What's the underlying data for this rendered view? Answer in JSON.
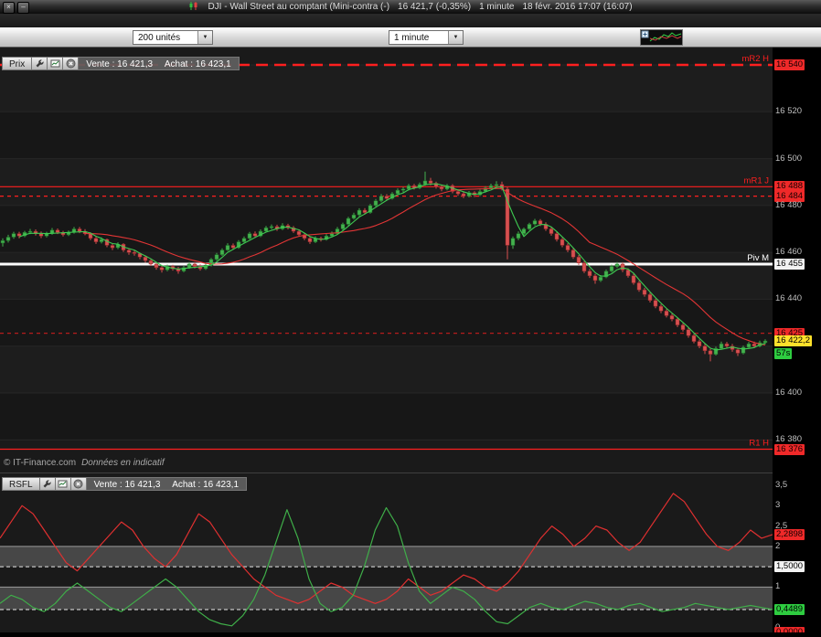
{
  "window": {
    "title_instrument": "DJI - Wall Street au comptant (Mini-contra (-)",
    "title_price": "16 421,7 (-0,35%)",
    "title_timeframe": "1 minute",
    "title_datetime": "18 févr. 2016 17:07 (16:07)"
  },
  "icons": {
    "close": "×",
    "minimize": "–",
    "dropdown": "▼"
  },
  "toolbar": {
    "units_select": "200 unités",
    "timeframe_select": "1 minute"
  },
  "price_panel": {
    "name": "Prix",
    "sell": "Vente : 16 421,3",
    "buy": "Achat : 16 423,1",
    "copyright": "© IT-Finance.com",
    "copyright_note": "Données en indicatif",
    "levels": [
      {
        "name": "mR2 H",
        "price": 16540,
        "style": "dashed-bold",
        "color": "#ff1f1f"
      },
      {
        "name": "mR1 J",
        "price": 16488,
        "style": "solid",
        "color": "#ff1f1f"
      },
      {
        "name": "",
        "price": 16484,
        "style": "dashed",
        "color": "#ff1f1f"
      },
      {
        "name": "Piv M",
        "price": 16455,
        "style": "solid-bold",
        "color": "#ffffff"
      },
      {
        "name": "",
        "price": 16425.5,
        "style": "dashed",
        "color": "#b51d1d"
      },
      {
        "name": "R1 H",
        "price": 16376,
        "style": "solid",
        "color": "#ff1f1f"
      }
    ],
    "axis_labels": [
      {
        "text": "16 540",
        "v": 16540,
        "type": "red"
      },
      {
        "text": "16 520",
        "v": 16520,
        "type": "plain"
      },
      {
        "text": "16 500",
        "v": 16500,
        "type": "plain"
      },
      {
        "text": "16 488",
        "v": 16488,
        "type": "red"
      },
      {
        "text": "16 484",
        "v": 16484,
        "type": "red"
      },
      {
        "text": "16 480",
        "v": 16480,
        "type": "plain"
      },
      {
        "text": "16 460",
        "v": 16460,
        "type": "plain"
      },
      {
        "text": "16 455",
        "v": 16455,
        "type": "white"
      },
      {
        "text": "16 440",
        "v": 16440,
        "type": "plain"
      },
      {
        "text": "16 425",
        "v": 16425.5,
        "type": "red"
      },
      {
        "text": "16 422,2",
        "v": 16422.2,
        "type": "yellow"
      },
      {
        "text": "57s",
        "v": 16416.6,
        "type": "green"
      },
      {
        "text": "16 400",
        "v": 16400,
        "type": "plain"
      },
      {
        "text": "16 380",
        "v": 16380,
        "type": "plain"
      },
      {
        "text": "16 376",
        "v": 16376,
        "type": "red"
      }
    ]
  },
  "rsfl_panel": {
    "name": "RSFL",
    "sell": "Vente : 16 421,3",
    "buy": "Achat : 16 423,1",
    "axis_labels": [
      {
        "text": "3,5",
        "v": 3.5,
        "type": "plain"
      },
      {
        "text": "3",
        "v": 3,
        "type": "plain"
      },
      {
        "text": "2,5",
        "v": 2.5,
        "type": "plain"
      },
      {
        "text": "2,2898",
        "v": 2.2898,
        "type": "red"
      },
      {
        "text": "2",
        "v": 2,
        "type": "plain"
      },
      {
        "text": "1,5000",
        "v": 1.5,
        "type": "white"
      },
      {
        "text": "1",
        "v": 1,
        "type": "plain"
      },
      {
        "text": "0,4489",
        "v": 0.4489,
        "type": "green"
      },
      {
        "text": "0",
        "v": 0,
        "type": "plain"
      },
      {
        "text": "0,0000",
        "v": -0.1,
        "type": "red"
      }
    ]
  },
  "chart_data": [
    {
      "type": "candlestick",
      "title": "DJI - Wall Street au comptant, 1 minute",
      "ylabel": "Prix",
      "ylim": [
        16368,
        16548
      ],
      "base": 16400,
      "gridlines": [
        16540,
        16520,
        16500,
        16480,
        16460,
        16440,
        16420,
        16400,
        16380
      ],
      "ma_fast_period": 4,
      "ma_slow_period": 16,
      "colors": {
        "up": "#44b14e",
        "up_border": "#1d6e26",
        "down": "#d75050",
        "down_border": "#8f2727",
        "ma_fast": "#3ecb52",
        "ma_slow": "#e23535"
      },
      "candles_ohlc_offset": [
        [
          64,
          66,
          62.5,
          65
        ],
        [
          65,
          67.5,
          64.2,
          66.5
        ],
        [
          66.5,
          68.8,
          65.8,
          68
        ],
        [
          68,
          68.8,
          66,
          67
        ],
        [
          67,
          69.2,
          66.5,
          68.5
        ],
        [
          68.5,
          70,
          67.8,
          69
        ],
        [
          69,
          69.8,
          67.2,
          68
        ],
        [
          68,
          68.9,
          66.1,
          67
        ],
        [
          67,
          68.8,
          66.4,
          68
        ],
        [
          68,
          70.4,
          67.5,
          69.5
        ],
        [
          69.5,
          70.2,
          67.8,
          68.5
        ],
        [
          68.5,
          69.2,
          66.8,
          67.5
        ],
        [
          67.5,
          69.3,
          67,
          68.5
        ],
        [
          68.5,
          70.8,
          68,
          70
        ],
        [
          70,
          70.8,
          68.2,
          69
        ],
        [
          69,
          69.9,
          67.3,
          68
        ],
        [
          68,
          68.6,
          65.2,
          66
        ],
        [
          66,
          66.8,
          63.6,
          64.5
        ],
        [
          64.5,
          66.4,
          63.8,
          65.5
        ],
        [
          65.5,
          65.9,
          62.2,
          63
        ],
        [
          63,
          63.9,
          61,
          62
        ],
        [
          62,
          64.3,
          61.4,
          63.5
        ],
        [
          63.5,
          63.9,
          60.2,
          61
        ],
        [
          61,
          61.8,
          59,
          60
        ],
        [
          60,
          60.9,
          58.6,
          59.5
        ],
        [
          59.5,
          59.9,
          57.1,
          58
        ],
        [
          58,
          58.7,
          55.6,
          56.5
        ],
        [
          56.5,
          57.2,
          54.2,
          55
        ],
        [
          55,
          55.8,
          52.6,
          53.5
        ],
        [
          53.5,
          54.2,
          51.4,
          52.5
        ],
        [
          52.5,
          54.8,
          51.9,
          54
        ],
        [
          54,
          54.7,
          52.2,
          53
        ],
        [
          53,
          53.8,
          50.9,
          52
        ],
        [
          52,
          54.2,
          51.5,
          53.5
        ],
        [
          53.5,
          55.9,
          53,
          55
        ],
        [
          55,
          55.8,
          53.1,
          54
        ],
        [
          54,
          54.9,
          52.2,
          53
        ],
        [
          53,
          55.2,
          52.5,
          54.5
        ],
        [
          54.5,
          57.6,
          54,
          57
        ],
        [
          57,
          59.8,
          56.4,
          59
        ],
        [
          59,
          61.7,
          58.5,
          61
        ],
        [
          61,
          63.9,
          60.6,
          63
        ],
        [
          63,
          63.8,
          61.2,
          62
        ],
        [
          62,
          65.2,
          61.5,
          64.5
        ],
        [
          64.5,
          66.8,
          64,
          66
        ],
        [
          66,
          68.7,
          65.5,
          68
        ],
        [
          68,
          68.9,
          66.2,
          67
        ],
        [
          67,
          69.8,
          66.5,
          69
        ],
        [
          69,
          71.3,
          68.5,
          70.5
        ],
        [
          70.5,
          71.9,
          69.8,
          71
        ],
        [
          71,
          71.8,
          69.2,
          70
        ],
        [
          70,
          72.4,
          69.5,
          71.5
        ],
        [
          71.5,
          72.2,
          69.8,
          70.5
        ],
        [
          70.5,
          71.2,
          68.3,
          69
        ],
        [
          69,
          69.8,
          66.9,
          67.5
        ],
        [
          67.5,
          68.2,
          65.2,
          66
        ],
        [
          66,
          66.8,
          63.6,
          64.5
        ],
        [
          64.5,
          66.9,
          64,
          66
        ],
        [
          66,
          66.7,
          64.6,
          65.5
        ],
        [
          65.5,
          67.8,
          65,
          67
        ],
        [
          67,
          68.9,
          66.4,
          68
        ],
        [
          68,
          70.8,
          67.5,
          70
        ],
        [
          70,
          72.7,
          69.4,
          72
        ],
        [
          72,
          75.2,
          71.5,
          74.5
        ],
        [
          74.5,
          76.9,
          74,
          76
        ],
        [
          76,
          78.8,
          75.4,
          78
        ],
        [
          78,
          78.9,
          76.2,
          77
        ],
        [
          77,
          80.7,
          76.5,
          80
        ],
        [
          80,
          82.8,
          79.5,
          82
        ],
        [
          82,
          84.9,
          81.4,
          84
        ],
        [
          84,
          84.8,
          82.2,
          83
        ],
        [
          83,
          85.7,
          82.5,
          85
        ],
        [
          85,
          87.3,
          84.5,
          86.5
        ],
        [
          86.5,
          87.9,
          85.6,
          87
        ],
        [
          87,
          89.2,
          86.4,
          88.5
        ],
        [
          88.5,
          89.2,
          86.8,
          87.5
        ],
        [
          87.5,
          89.8,
          87,
          89
        ],
        [
          89,
          94.5,
          88.4,
          90.5
        ],
        [
          90.5,
          91.8,
          88.6,
          89.5
        ],
        [
          89.5,
          90.2,
          87.2,
          88
        ],
        [
          88,
          88.9,
          86.1,
          87
        ],
        [
          87,
          89.2,
          86.5,
          88.5
        ],
        [
          88.5,
          89.1,
          85.2,
          86
        ],
        [
          86,
          86.9,
          84.1,
          85
        ],
        [
          85,
          85.8,
          83.2,
          84
        ],
        [
          84,
          86.2,
          83.5,
          85.5
        ],
        [
          85.5,
          86.1,
          83.6,
          84.5
        ],
        [
          84.5,
          86.8,
          84,
          86
        ],
        [
          86,
          88.2,
          85.5,
          87.5
        ],
        [
          87.5,
          89.3,
          87,
          88.5
        ],
        [
          88.5,
          90.4,
          87.8,
          89
        ],
        [
          89,
          90.2,
          86.4,
          87
        ],
        [
          87,
          87.8,
          57,
          63
        ],
        [
          63,
          66.8,
          61.5,
          66
        ],
        [
          66,
          68.9,
          65.2,
          68
        ],
        [
          68,
          70.6,
          67.4,
          70
        ],
        [
          70,
          72.6,
          69.5,
          72
        ],
        [
          72,
          74.3,
          71.5,
          73.5
        ],
        [
          73.5,
          74.2,
          71.2,
          72
        ],
        [
          72,
          72.8,
          69.2,
          70
        ],
        [
          70,
          70.9,
          67.1,
          68
        ],
        [
          68,
          68.7,
          64.6,
          65.5
        ],
        [
          65.5,
          66.2,
          62.2,
          63
        ],
        [
          63,
          63.9,
          60.1,
          61
        ],
        [
          61,
          61.8,
          57.2,
          58
        ],
        [
          58,
          58.9,
          54.6,
          55.5
        ],
        [
          55.5,
          56.2,
          51.2,
          52
        ],
        [
          52,
          52.9,
          49.1,
          50
        ],
        [
          50,
          50.8,
          46.6,
          48
        ],
        [
          48,
          50.3,
          47.4,
          49.5
        ],
        [
          49.5,
          52.7,
          49,
          52
        ],
        [
          52,
          54.8,
          51.5,
          54
        ],
        [
          54,
          55.9,
          53.4,
          55
        ],
        [
          55,
          55.8,
          51.6,
          52.5
        ],
        [
          52.5,
          53.2,
          49.2,
          50
        ],
        [
          50,
          50.9,
          46.2,
          47
        ],
        [
          47,
          47.8,
          43.2,
          44
        ],
        [
          44,
          44.9,
          41.1,
          42
        ],
        [
          42,
          42.8,
          38.6,
          39.5
        ],
        [
          39.5,
          40.2,
          36.2,
          37
        ],
        [
          37,
          37.9,
          34.1,
          35
        ],
        [
          35,
          35.8,
          32.2,
          33
        ],
        [
          33,
          33.9,
          30.6,
          31.5
        ],
        [
          31.5,
          32.2,
          28.1,
          29
        ],
        [
          29,
          29.8,
          26.2,
          27
        ],
        [
          27,
          27.9,
          23.6,
          24.5
        ],
        [
          24.5,
          25.2,
          21.2,
          22
        ],
        [
          22,
          22.8,
          19.1,
          20
        ],
        [
          20,
          20.9,
          16.6,
          18
        ],
        [
          18,
          18.8,
          13.5,
          16.5
        ],
        [
          16.5,
          19.8,
          16,
          19
        ],
        [
          19,
          21.9,
          18.5,
          21
        ],
        [
          21,
          21.8,
          19.2,
          20
        ],
        [
          20,
          20.9,
          17.6,
          18.5
        ],
        [
          18.5,
          19.2,
          15.8,
          17
        ],
        [
          17,
          20.2,
          16.5,
          19.5
        ],
        [
          19.5,
          21.8,
          19,
          21
        ],
        [
          21,
          21.9,
          19.2,
          20
        ],
        [
          20,
          22.3,
          19.5,
          21.5
        ],
        [
          21.5,
          22.9,
          20.8,
          22.2
        ]
      ]
    },
    {
      "type": "line",
      "title": "RSFL",
      "ylim": [
        0,
        3.5
      ],
      "bands": [
        [
          1.5,
          2.0
        ],
        [
          0.4489,
          1.0
        ]
      ],
      "guides": [
        {
          "v": 2,
          "style": "solid"
        },
        {
          "v": 1.5,
          "style": "dashed"
        },
        {
          "v": 1,
          "style": "solid"
        },
        {
          "v": 0.4489,
          "style": "dashed"
        }
      ],
      "series": [
        {
          "name": "rsfl-red",
          "color": "#e03030",
          "values": [
            2.2,
            2.6,
            3.0,
            2.8,
            2.4,
            2.0,
            1.6,
            1.4,
            1.7,
            2.0,
            2.3,
            2.6,
            2.4,
            2.0,
            1.7,
            1.5,
            1.8,
            2.3,
            2.8,
            2.6,
            2.2,
            1.8,
            1.5,
            1.2,
            1.0,
            0.8,
            0.7,
            0.6,
            0.7,
            0.9,
            1.1,
            1.0,
            0.8,
            0.7,
            0.6,
            0.7,
            0.9,
            1.2,
            1.0,
            0.8,
            0.9,
            1.1,
            1.3,
            1.2,
            1.0,
            0.9,
            1.1,
            1.4,
            1.8,
            2.2,
            2.5,
            2.3,
            2.0,
            2.2,
            2.5,
            2.4,
            2.1,
            1.9,
            2.1,
            2.5,
            2.9,
            3.3,
            3.1,
            2.7,
            2.3,
            2.0,
            1.9,
            2.1,
            2.4,
            2.2,
            2.29
          ]
        },
        {
          "name": "rsfl-green",
          "color": "#3fae49",
          "values": [
            0.6,
            0.8,
            0.7,
            0.5,
            0.4,
            0.6,
            0.9,
            1.1,
            0.9,
            0.7,
            0.5,
            0.4,
            0.6,
            0.8,
            1.0,
            1.2,
            1.0,
            0.7,
            0.4,
            0.2,
            0.1,
            0.05,
            0.3,
            0.7,
            1.3,
            2.1,
            2.9,
            2.2,
            1.2,
            0.6,
            0.4,
            0.5,
            0.8,
            1.5,
            2.4,
            2.95,
            2.5,
            1.6,
            0.9,
            0.6,
            0.8,
            1.0,
            0.9,
            0.7,
            0.4,
            0.15,
            0.1,
            0.3,
            0.5,
            0.6,
            0.5,
            0.45,
            0.55,
            0.65,
            0.6,
            0.5,
            0.45,
            0.55,
            0.6,
            0.5,
            0.4,
            0.45,
            0.5,
            0.6,
            0.55,
            0.5,
            0.45,
            0.5,
            0.55,
            0.5,
            0.45
          ]
        }
      ]
    }
  ]
}
